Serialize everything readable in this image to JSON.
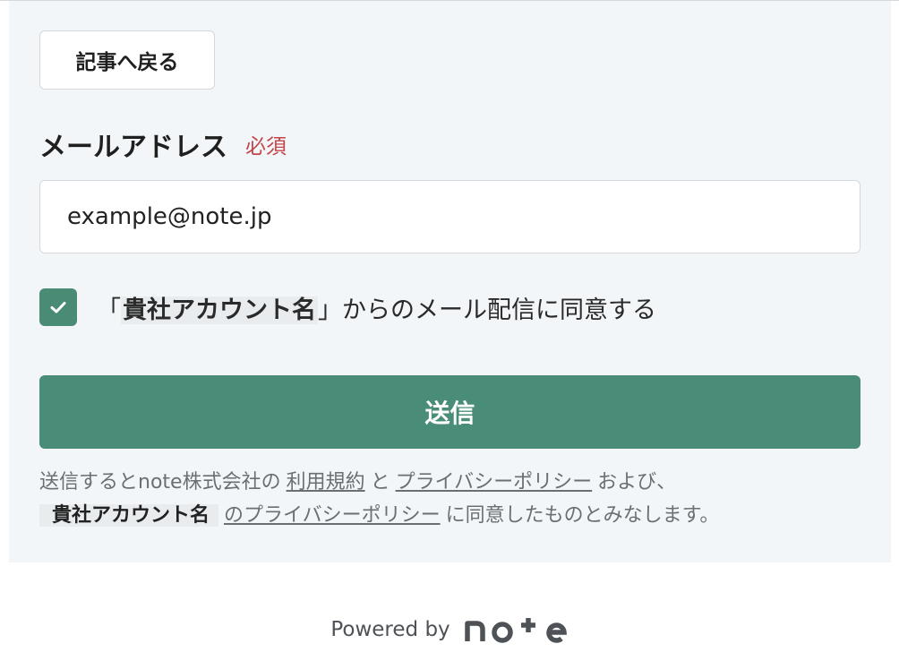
{
  "navigation": {
    "back_label": "記事へ戻る"
  },
  "email_field": {
    "label": "メールアドレス",
    "required_label": "必須",
    "value": "example@note.jp"
  },
  "consent": {
    "checked": true,
    "open_bracket": "「",
    "account_name": "貴社アカウント名",
    "close_bracket": "」",
    "text": "からのメール配信に同意する"
  },
  "submit": {
    "label": "送信"
  },
  "legal": {
    "prefix": "送信するとnote株式会社の",
    "terms_link": "利用規約",
    "and": "と",
    "privacy_link": "プライバシーポリシー",
    "and_also": "および、",
    "account_name": "貴社アカウント名",
    "account_privacy_link": "のプライバシーポリシー",
    "suffix": "に同意したものとみなします。"
  },
  "footer": {
    "powered_by": "Powered by",
    "logo_text": "note"
  },
  "colors": {
    "accent": "#498c77",
    "required": "#c2454a",
    "panel_background": "#f3f6f9"
  }
}
